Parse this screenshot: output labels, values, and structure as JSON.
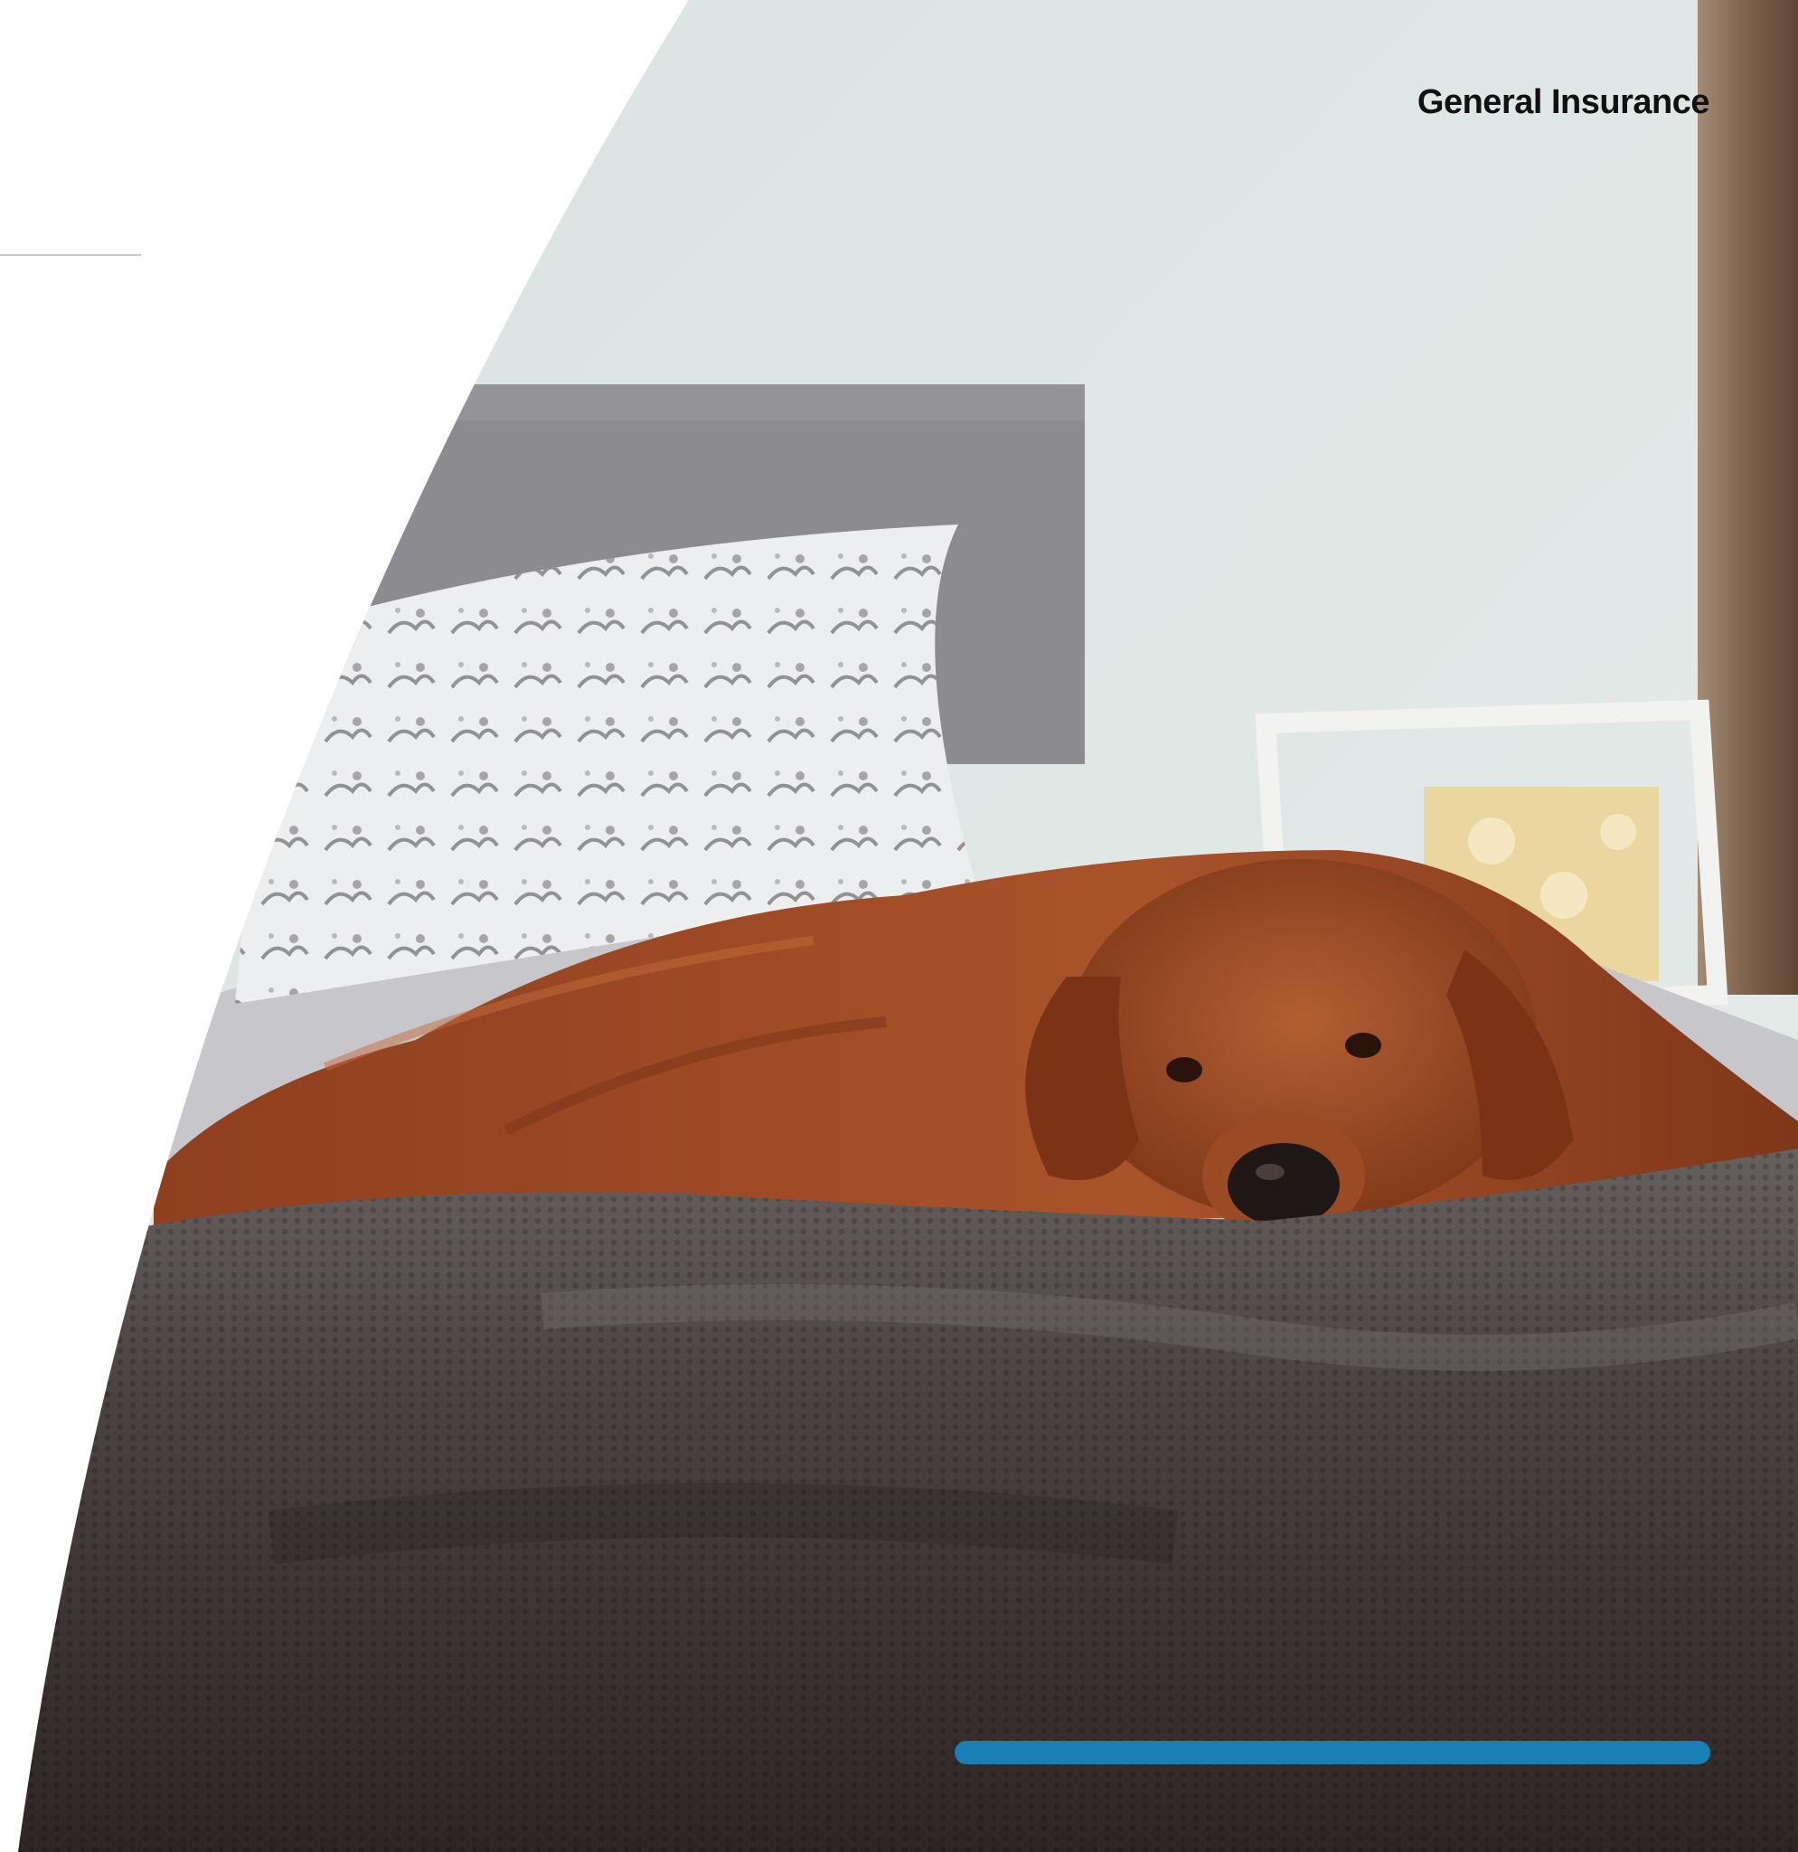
{
  "header": {
    "label": "General Insurance"
  },
  "colors": {
    "accent": "#1a7fb5",
    "background": "#ffffff",
    "text": "#111111"
  },
  "photo": {
    "subject": "dog-on-bed-photo"
  }
}
